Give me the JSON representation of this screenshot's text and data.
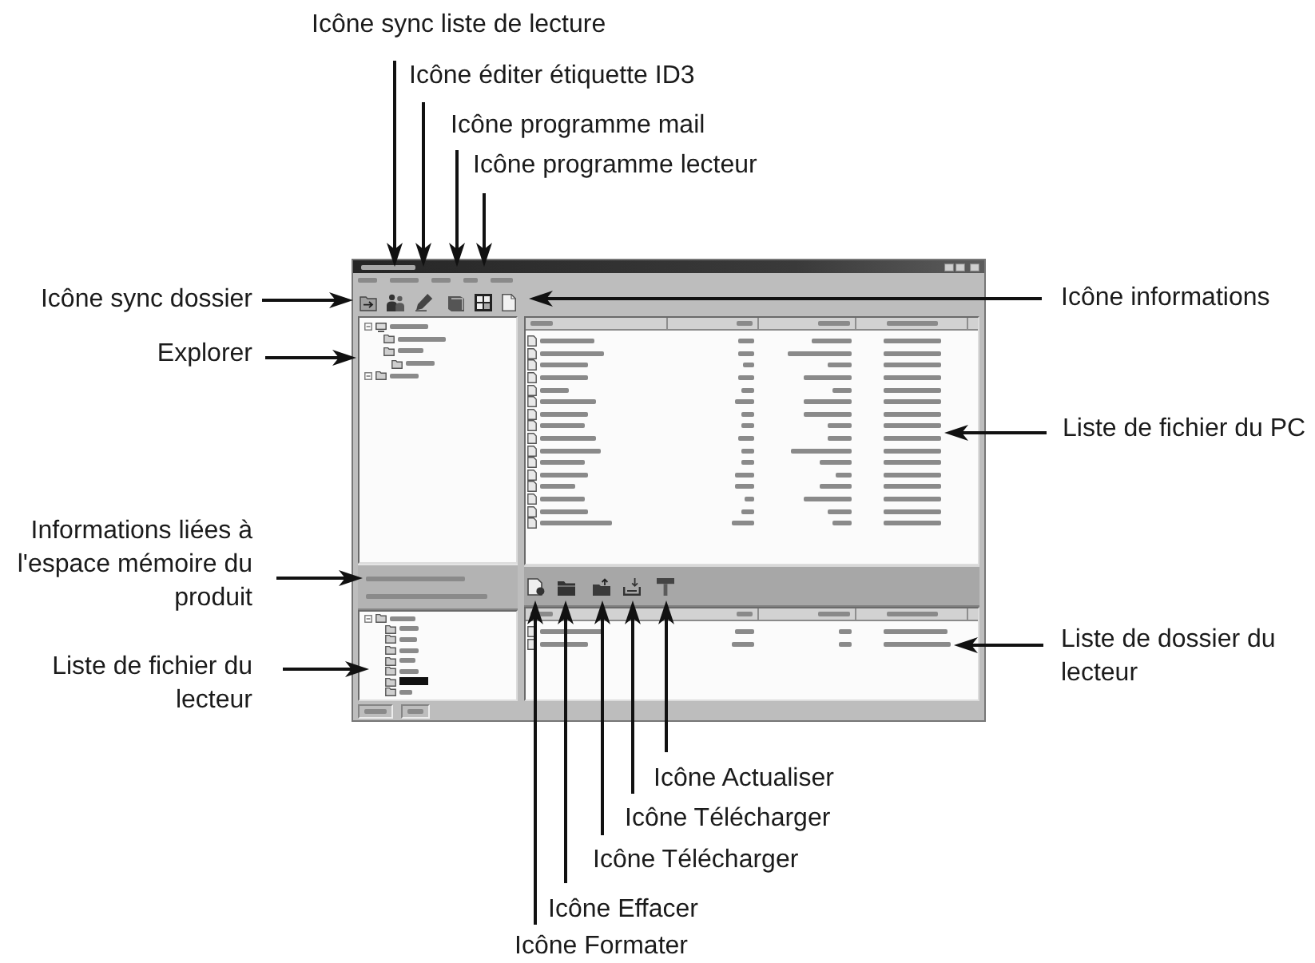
{
  "callouts": [
    {
      "text": "Icône sync liste de lecture"
    },
    {
      "text": "Icône éditer étiquette ID3"
    },
    {
      "text": "Icône programme mail"
    },
    {
      "text": "Icône programme lecteur"
    },
    {
      "text": "Icône sync dossier"
    },
    {
      "text": "Icône informations"
    },
    {
      "text": "Explorer"
    },
    {
      "text": "Liste de fichier du PC"
    },
    {
      "text": "Informations liées à l'espace mémoire du produit"
    },
    {
      "text": "Liste de fichier du lecteur"
    },
    {
      "text": "Liste de dossier du lecteur"
    },
    {
      "text": "Icône Actualiser"
    },
    {
      "text": "Icône Télécharger"
    },
    {
      "text": "Icône Télécharger"
    },
    {
      "text": "Icône Effacer"
    },
    {
      "text": "Icône Formater"
    }
  ],
  "app_window": {
    "player_file_tree": [
      {
        "selected": false,
        "children": [
          {
            "selected": false
          },
          {
            "selected": false
          },
          {
            "selected": false
          },
          {
            "selected": false
          },
          {
            "selected": false
          },
          {
            "selected": true
          },
          {
            "selected": false
          }
        ]
      }
    ]
  }
}
